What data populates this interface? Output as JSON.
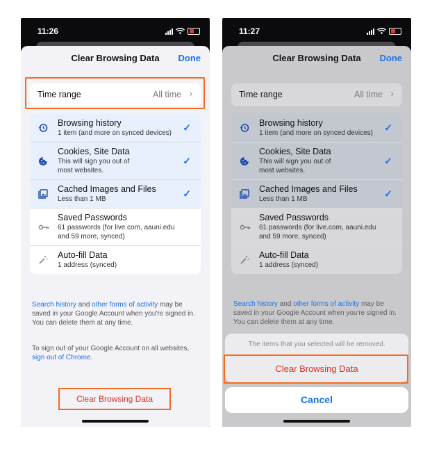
{
  "left": {
    "status_time": "11:26",
    "title": "Clear Browsing Data",
    "done": "Done",
    "time_range": {
      "label": "Time range",
      "value": "All time"
    },
    "items": [
      {
        "title": "Browsing history",
        "sub1": "1 item (and more on synced devices)",
        "sub2": "",
        "icon": "history-icon",
        "checked": true
      },
      {
        "title": "Cookies, Site Data",
        "sub1": "This will sign you out of",
        "sub2": "most websites.",
        "icon": "cookie-icon",
        "checked": true
      },
      {
        "title": "Cached Images and Files",
        "sub1": "Less than 1 MB",
        "sub2": "",
        "icon": "image-icon",
        "checked": true
      },
      {
        "title": "Saved Passwords",
        "sub1": "61 passwords (for live.com, aauni.edu",
        "sub2": "and 59 more, synced)",
        "icon": "key-icon",
        "checked": false
      },
      {
        "title": "Auto-fill Data",
        "sub1": "1 address (synced)",
        "sub2": "",
        "icon": "magic-wand-icon",
        "checked": false
      }
    ],
    "foot1": {
      "link1": "Search history",
      "mid": " and ",
      "link2": "other forms of activity",
      "rest": " may be saved in your Google Account when you're signed in. You can delete them at any time."
    },
    "foot2": {
      "pre": "To sign out of your Google Account on all websites, ",
      "link": "sign out of Chrome",
      "post": "."
    },
    "clear_button": "Clear Browsing Data"
  },
  "right": {
    "status_time": "11:27",
    "title": "Clear Browsing Data",
    "done": "Done",
    "time_range": {
      "label": "Time range",
      "value": "All time"
    },
    "items": [
      {
        "title": "Browsing history",
        "sub1": "1 item (and more on synced devices)",
        "sub2": "",
        "icon": "history-icon",
        "checked": true
      },
      {
        "title": "Cookies, Site Data",
        "sub1": "This will sign you out of",
        "sub2": "most websites.",
        "icon": "cookie-icon",
        "checked": true
      },
      {
        "title": "Cached Images and Files",
        "sub1": "Less than 1 MB",
        "sub2": "",
        "icon": "image-icon",
        "checked": true
      },
      {
        "title": "Saved Passwords",
        "sub1": "61 passwords (for live.com, aauni.edu",
        "sub2": "and 59 more, synced)",
        "icon": "key-icon",
        "checked": false
      },
      {
        "title": "Auto-fill Data",
        "sub1": "1 address (synced)",
        "sub2": "",
        "icon": "magic-wand-icon",
        "checked": false
      }
    ],
    "foot1": {
      "link1": "Search history",
      "mid": " and ",
      "link2": "other forms of activity",
      "rest": " may be saved in your Google Account when you're signed in. You can delete them at any time."
    },
    "action_sheet": {
      "message": "The items that you selected will be removed.",
      "confirm": "Clear Browsing Data",
      "cancel": "Cancel"
    }
  },
  "colors": {
    "accent": "#1a73e8",
    "destructive": "#d93025",
    "highlight": "#f36c21"
  }
}
